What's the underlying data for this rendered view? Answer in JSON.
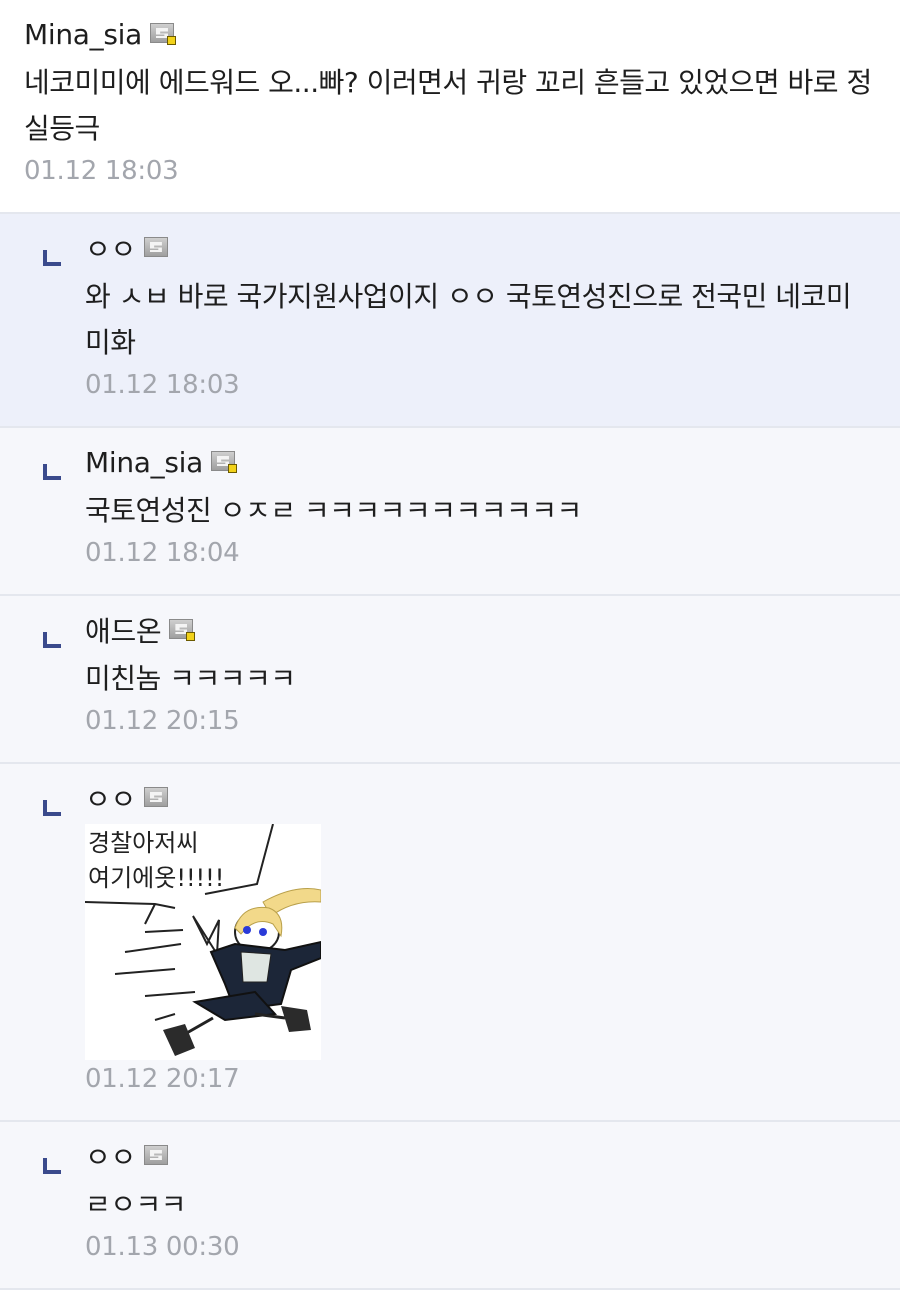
{
  "comments": [
    {
      "nick": "Mina_sia",
      "text": "네코미미에 에드워드 오...빠? 이러면서 귀랑 꼬리 흔들고 있었으면 바로 정실등극",
      "time": "01.12 18:03"
    },
    {
      "nick": "ㅇㅇ",
      "text": "와 ㅅㅂ 바로 국가지원사업이지 ㅇㅇ 국토연성진으로 전국민 네코미미화",
      "time": "01.12 18:03"
    },
    {
      "nick": "Mina_sia",
      "text": "국토연성진 ㅇㅈㄹ ㅋㅋㅋㅋㅋㅋㅋㅋㅋㅋㅋ",
      "time": "01.12 18:04"
    },
    {
      "nick": "애드온",
      "text": "미친놈 ㅋㅋㅋㅋㅋ",
      "time": "01.12 20:15"
    },
    {
      "nick": "ㅇㅇ",
      "dccon_text": "경찰아저씨\n여기에옷!!!!!",
      "time": "01.12 20:17"
    },
    {
      "nick": "ㅇㅇ",
      "text": "ㄹㅇㅋㅋ",
      "time": "01.13 00:30"
    }
  ],
  "icons": {
    "reply": "reply-arrow-icon",
    "gallery_member": "gallery-member-badge-icon",
    "fixed_nick": "fixed-nick-badge-icon"
  },
  "colors": {
    "reply_bg": "#f6f7fb",
    "highlight_bg": "#edf0fa",
    "reply_mark": "#3a4a8c",
    "time": "#a3a6ad",
    "badge_dot": "#f2d21a"
  }
}
